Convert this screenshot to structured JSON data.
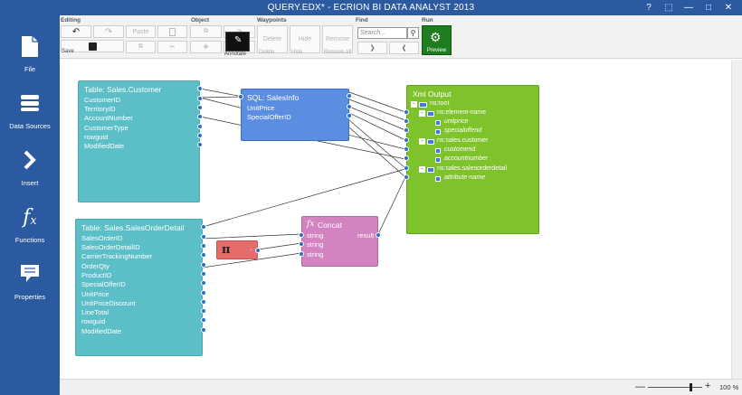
{
  "window": {
    "title": "QUERY.EDX* - ECRION BI DATA ANALYST 2013",
    "controls": [
      "?",
      "⬚",
      "—",
      "□",
      "✕"
    ]
  },
  "sidebar": {
    "items": [
      {
        "label": "File",
        "icon": "file-icon"
      },
      {
        "label": "Data Sources",
        "icon": "database-icon"
      },
      {
        "label": "Insert",
        "icon": "chevron-right-icon"
      },
      {
        "label": "Functions",
        "icon": "fx-icon"
      },
      {
        "label": "Properties",
        "icon": "speech-bubble-icon"
      }
    ]
  },
  "ribbon": {
    "groups": {
      "editing": "Editing",
      "object": "Object",
      "waypoints": "Waypoints",
      "find": "Find",
      "run": "Run"
    },
    "editing": {
      "save": "Save",
      "paste": "Paste"
    },
    "object": {
      "annotate": "Annotate"
    },
    "waypoints": {
      "delete": "Delete",
      "hide": "Hide",
      "remove": "Remove",
      "delete_sub": "Delete",
      "hide_sub": "Hide",
      "remove_all": "Remove All"
    },
    "find": {
      "search_placeholder": "Search..."
    },
    "run": {
      "preview": "Preview"
    }
  },
  "nodes": {
    "sales_customer": {
      "title": "Table: Sales.Customer",
      "fields": [
        "CustomerID",
        "TerritoryID",
        "AccountNumber",
        "CustomerType",
        "rowguid",
        "ModifiedDate"
      ]
    },
    "sales_order_detail": {
      "title": "Table: Sales.SalesOrderDetail",
      "fields": [
        "SalesOrderID",
        "SalesOrderDetailID",
        "CarrierTrackingNumber",
        "OrderQty",
        "ProductID",
        "SpecialOfferID",
        "UnitPrice",
        "UnitPriceDiscount",
        "LineTotal",
        "rowguid",
        "ModifiedDate"
      ]
    },
    "sales_info": {
      "title": "SQL: SalesInfo",
      "fields": [
        "UnitPrice",
        "SpecialOfferID"
      ]
    },
    "concat": {
      "title": "Concat",
      "inputs": [
        "string",
        "string",
        "string"
      ],
      "output": "result"
    },
    "pi": {
      "symbol": "π",
      "port": "·"
    },
    "xml_output": {
      "title": "Xml Output",
      "tree": [
        {
          "label": "ns:root",
          "kind": "root"
        },
        {
          "label": "ns:element-name",
          "kind": "element"
        },
        {
          "label": "unitprice",
          "kind": "attr"
        },
        {
          "label": "specialofferid",
          "kind": "attr"
        },
        {
          "label": "ns:sales.customer",
          "kind": "element"
        },
        {
          "label": "customerid",
          "kind": "attr"
        },
        {
          "label": "accountnumber",
          "kind": "attr"
        },
        {
          "label": "ns:sales.salesorderdetail",
          "kind": "element"
        },
        {
          "label": "attribute-name",
          "kind": "attr"
        }
      ]
    }
  },
  "status": {
    "zoom": "100 %",
    "zoom_level": 0.78
  },
  "colors": {
    "chrome": "#2c5aa0",
    "table": "#5cbfc8",
    "sql": "#5b8ee0",
    "concat": "#d383c0",
    "pi": "#e66b6b",
    "xml": "#7ec22c",
    "preview": "#1e7d1e"
  }
}
